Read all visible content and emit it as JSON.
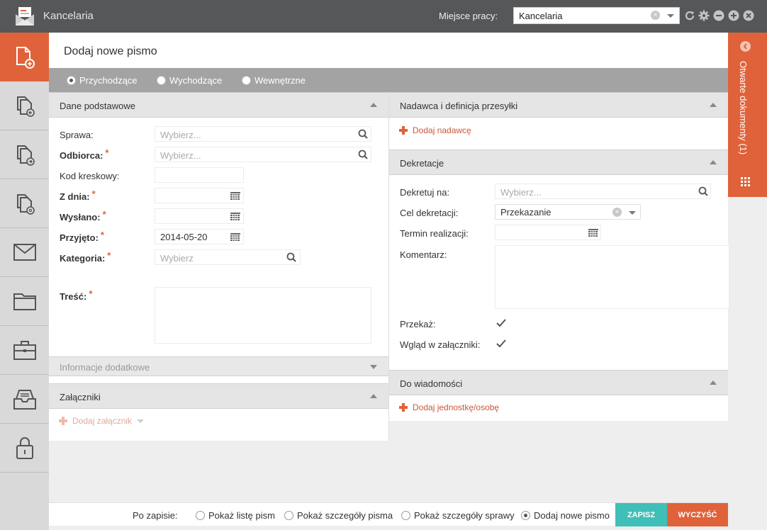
{
  "app": {
    "title": "Kancelaria"
  },
  "topbar": {
    "workplace_label": "Miejsce pracy:",
    "workplace_value": "Kancelaria"
  },
  "leftnav": {
    "items": [
      {
        "icon": "document-add-icon",
        "active": true
      },
      {
        "icon": "document-incoming-icon"
      },
      {
        "icon": "document-outgoing-icon"
      },
      {
        "icon": "document-email-icon"
      },
      {
        "icon": "envelope-icon"
      },
      {
        "icon": "folder-icon"
      },
      {
        "icon": "briefcase-icon"
      },
      {
        "icon": "inbox-tray-icon"
      },
      {
        "icon": "lock-icon"
      }
    ]
  },
  "rightpanel": {
    "label": "Otwarte dokumenty (1)"
  },
  "page": {
    "title": "Dodaj nowe pismo"
  },
  "type_radios": {
    "incoming": "Przychodzące",
    "outgoing": "Wychodzące",
    "internal": "Wewnętrzne",
    "selected": "incoming"
  },
  "basic": {
    "title": "Dane podstawowe",
    "sprawa_label": "Sprawa:",
    "sprawa_placeholder": "Wybierz...",
    "odbiorca_label": "Odbiorca:",
    "odbiorca_placeholder": "Wybierz...",
    "kod_label": "Kod kreskowy:",
    "zdnia_label": "Z dnia:",
    "wyslano_label": "Wysłano:",
    "przyjeto_label": "Przyjęto:",
    "przyjeto_value": "2014-05-20",
    "kategoria_label": "Kategoria:",
    "kategoria_placeholder": "Wybierz",
    "tresc_label": "Treść:",
    "required_mark": "*"
  },
  "additional": {
    "title": "Informacje dodatkowe"
  },
  "attachments": {
    "title": "Załączniki",
    "add_label": "Dodaj załącznik"
  },
  "sender": {
    "title": "Nadawca i definicja przesyłki",
    "add_label": "Dodaj nadawcę"
  },
  "decree": {
    "title": "Dekretacje",
    "dekretuj_label": "Dekretuj na:",
    "dekretuj_placeholder": "Wybierz...",
    "cel_label": "Cel dekretacji:",
    "cel_value": "Przekazanie",
    "termin_label": "Termin realizacji:",
    "komentarz_label": "Komentarz:",
    "przekaz_label": "Przekaż:",
    "przekaz_checked": true,
    "wglad_label": "Wgląd w załączniki:",
    "wglad_checked": true
  },
  "notify": {
    "title": "Do wiadomości",
    "add_label": "Dodaj jednostkę/osobę"
  },
  "bottombar": {
    "after_label": "Po zapisie:",
    "opt_list": "Pokaż listę pism",
    "opt_details": "Pokaż szczegóły pisma",
    "opt_case": "Pokaż szczegóły sprawy",
    "opt_new": "Dodaj nowe pismo",
    "selected": "opt_new",
    "save_label": "ZAPISZ",
    "clear_label": "WYCZYŚĆ"
  },
  "colors": {
    "accent": "#e0623a",
    "save": "#3fbfb8",
    "topbar": "#555759"
  }
}
